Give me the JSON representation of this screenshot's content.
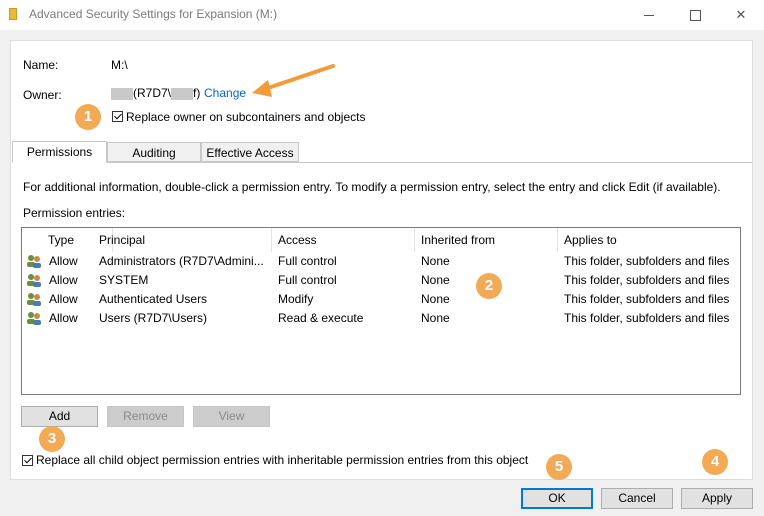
{
  "window": {
    "title": "Advanced Security Settings for Expansion (M:)",
    "title_color": "#7a7a7a"
  },
  "fields": {
    "name_label": "Name:",
    "name_value": "M:\\",
    "owner_label": "Owner:",
    "owner_value_domain": "(R7D7\\",
    "owner_value_end": "f)",
    "change_link": "Change",
    "replace_owner_label": "Replace owner on subcontainers and objects",
    "replace_owner_checked": true
  },
  "tabs": [
    {
      "label": "Permissions",
      "active": true
    },
    {
      "label": "Auditing",
      "active": false
    },
    {
      "label": "Effective Access",
      "active": false
    }
  ],
  "permissions": {
    "info_text": "For additional information, double-click a permission entry. To modify a permission entry, select the entry and click Edit (if available).",
    "entries_label": "Permission entries:",
    "columns": [
      "Type",
      "Principal",
      "Access",
      "Inherited from",
      "Applies to"
    ],
    "rows": [
      {
        "type": "Allow",
        "principal": "Administrators (R7D7\\Admini...",
        "access": "Full control",
        "inherited": "None",
        "applies": "This folder, subfolders and files"
      },
      {
        "type": "Allow",
        "principal": "SYSTEM",
        "access": "Full control",
        "inherited": "None",
        "applies": "This folder, subfolders and files"
      },
      {
        "type": "Allow",
        "principal": "Authenticated Users",
        "access": "Modify",
        "inherited": "None",
        "applies": "This folder, subfolders and files"
      },
      {
        "type": "Allow",
        "principal": "Users (R7D7\\Users)",
        "access": "Read & execute",
        "inherited": "None",
        "applies": "This folder, subfolders and files"
      }
    ],
    "add_button": "Add",
    "remove_button": "Remove",
    "view_button": "View",
    "replace_child_label": "Replace all child object permission entries with inheritable permission entries from this object",
    "replace_child_checked": true
  },
  "footer": {
    "ok_button": "OK",
    "cancel_button": "Cancel",
    "apply_button": "Apply"
  },
  "annotations": {
    "badges": [
      "1",
      "2",
      "3",
      "4",
      "5"
    ],
    "badge_color": "#f3a64e",
    "arrow_color": "#f39a3c"
  },
  "colors": {
    "link": "#0a64c8",
    "default_button_border": "#0078d7"
  }
}
